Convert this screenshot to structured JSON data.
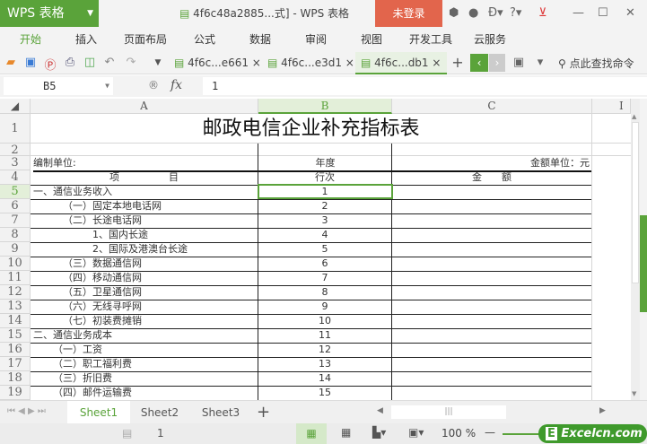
{
  "app": {
    "name": "WPS 表格",
    "title": "4f6c48a2885...式] - WPS 表格",
    "login": "未登录"
  },
  "menu": [
    "开始",
    "插入",
    "页面布局",
    "公式",
    "数据",
    "审阅",
    "视图",
    "开发工具",
    "云服务"
  ],
  "doc_tabs": [
    {
      "label": "4f6c...e661"
    },
    {
      "label": "4f6c...e3d1"
    },
    {
      "label": "4f6c...db1"
    }
  ],
  "search_cmd": "点此查找命令",
  "formula": {
    "cell": "B5",
    "fx": "fx",
    "value": "1"
  },
  "columns": [
    "A",
    "B",
    "C",
    "I"
  ],
  "sheet": {
    "title": "邮政电信企业补充指标表",
    "unit_label": "编制单位:",
    "year_label": "年度",
    "amount_unit": "金额单位：元",
    "h_item": "项　　　　　目",
    "h_line": "行次",
    "h_amount": "金　　额",
    "rows": [
      {
        "n": "5",
        "item": "一、通信业务收入",
        "line": "1",
        "indent": 0
      },
      {
        "n": "6",
        "item": "（一）固定本地电话网",
        "line": "2",
        "indent": 3
      },
      {
        "n": "7",
        "item": "（二）长途电话网",
        "line": "3",
        "indent": 3
      },
      {
        "n": "8",
        "item": "1、国内长途",
        "line": "4",
        "indent": 6
      },
      {
        "n": "9",
        "item": "2、国际及港澳台长途",
        "line": "5",
        "indent": 6
      },
      {
        "n": "10",
        "item": "（三）数据通信网",
        "line": "6",
        "indent": 3
      },
      {
        "n": "11",
        "item": "（四）移动通信网",
        "line": "7",
        "indent": 3
      },
      {
        "n": "12",
        "item": "（五）卫星通信网",
        "line": "8",
        "indent": 3
      },
      {
        "n": "13",
        "item": "（六）无线寻呼网",
        "line": "9",
        "indent": 3
      },
      {
        "n": "14",
        "item": "（七）初装费摊销",
        "line": "10",
        "indent": 3
      },
      {
        "n": "15",
        "item": "二、通信业务成本",
        "line": "11",
        "indent": 0
      },
      {
        "n": "16",
        "item": "（一）工资",
        "line": "12",
        "indent": 2
      },
      {
        "n": "17",
        "item": "（二）职工福利费",
        "line": "13",
        "indent": 2
      },
      {
        "n": "18",
        "item": "（三）折旧费",
        "line": "14",
        "indent": 2
      },
      {
        "n": "19",
        "item": "（四）邮件运输费",
        "line": "15",
        "indent": 2
      }
    ]
  },
  "row_numbers_top": [
    "1",
    "2",
    "3",
    "4"
  ],
  "sheet_tabs": [
    "Sheet1",
    "Sheet2",
    "Sheet3"
  ],
  "status": {
    "page": "1",
    "zoom": "100 %",
    "watermark": "Excelcn.com"
  }
}
